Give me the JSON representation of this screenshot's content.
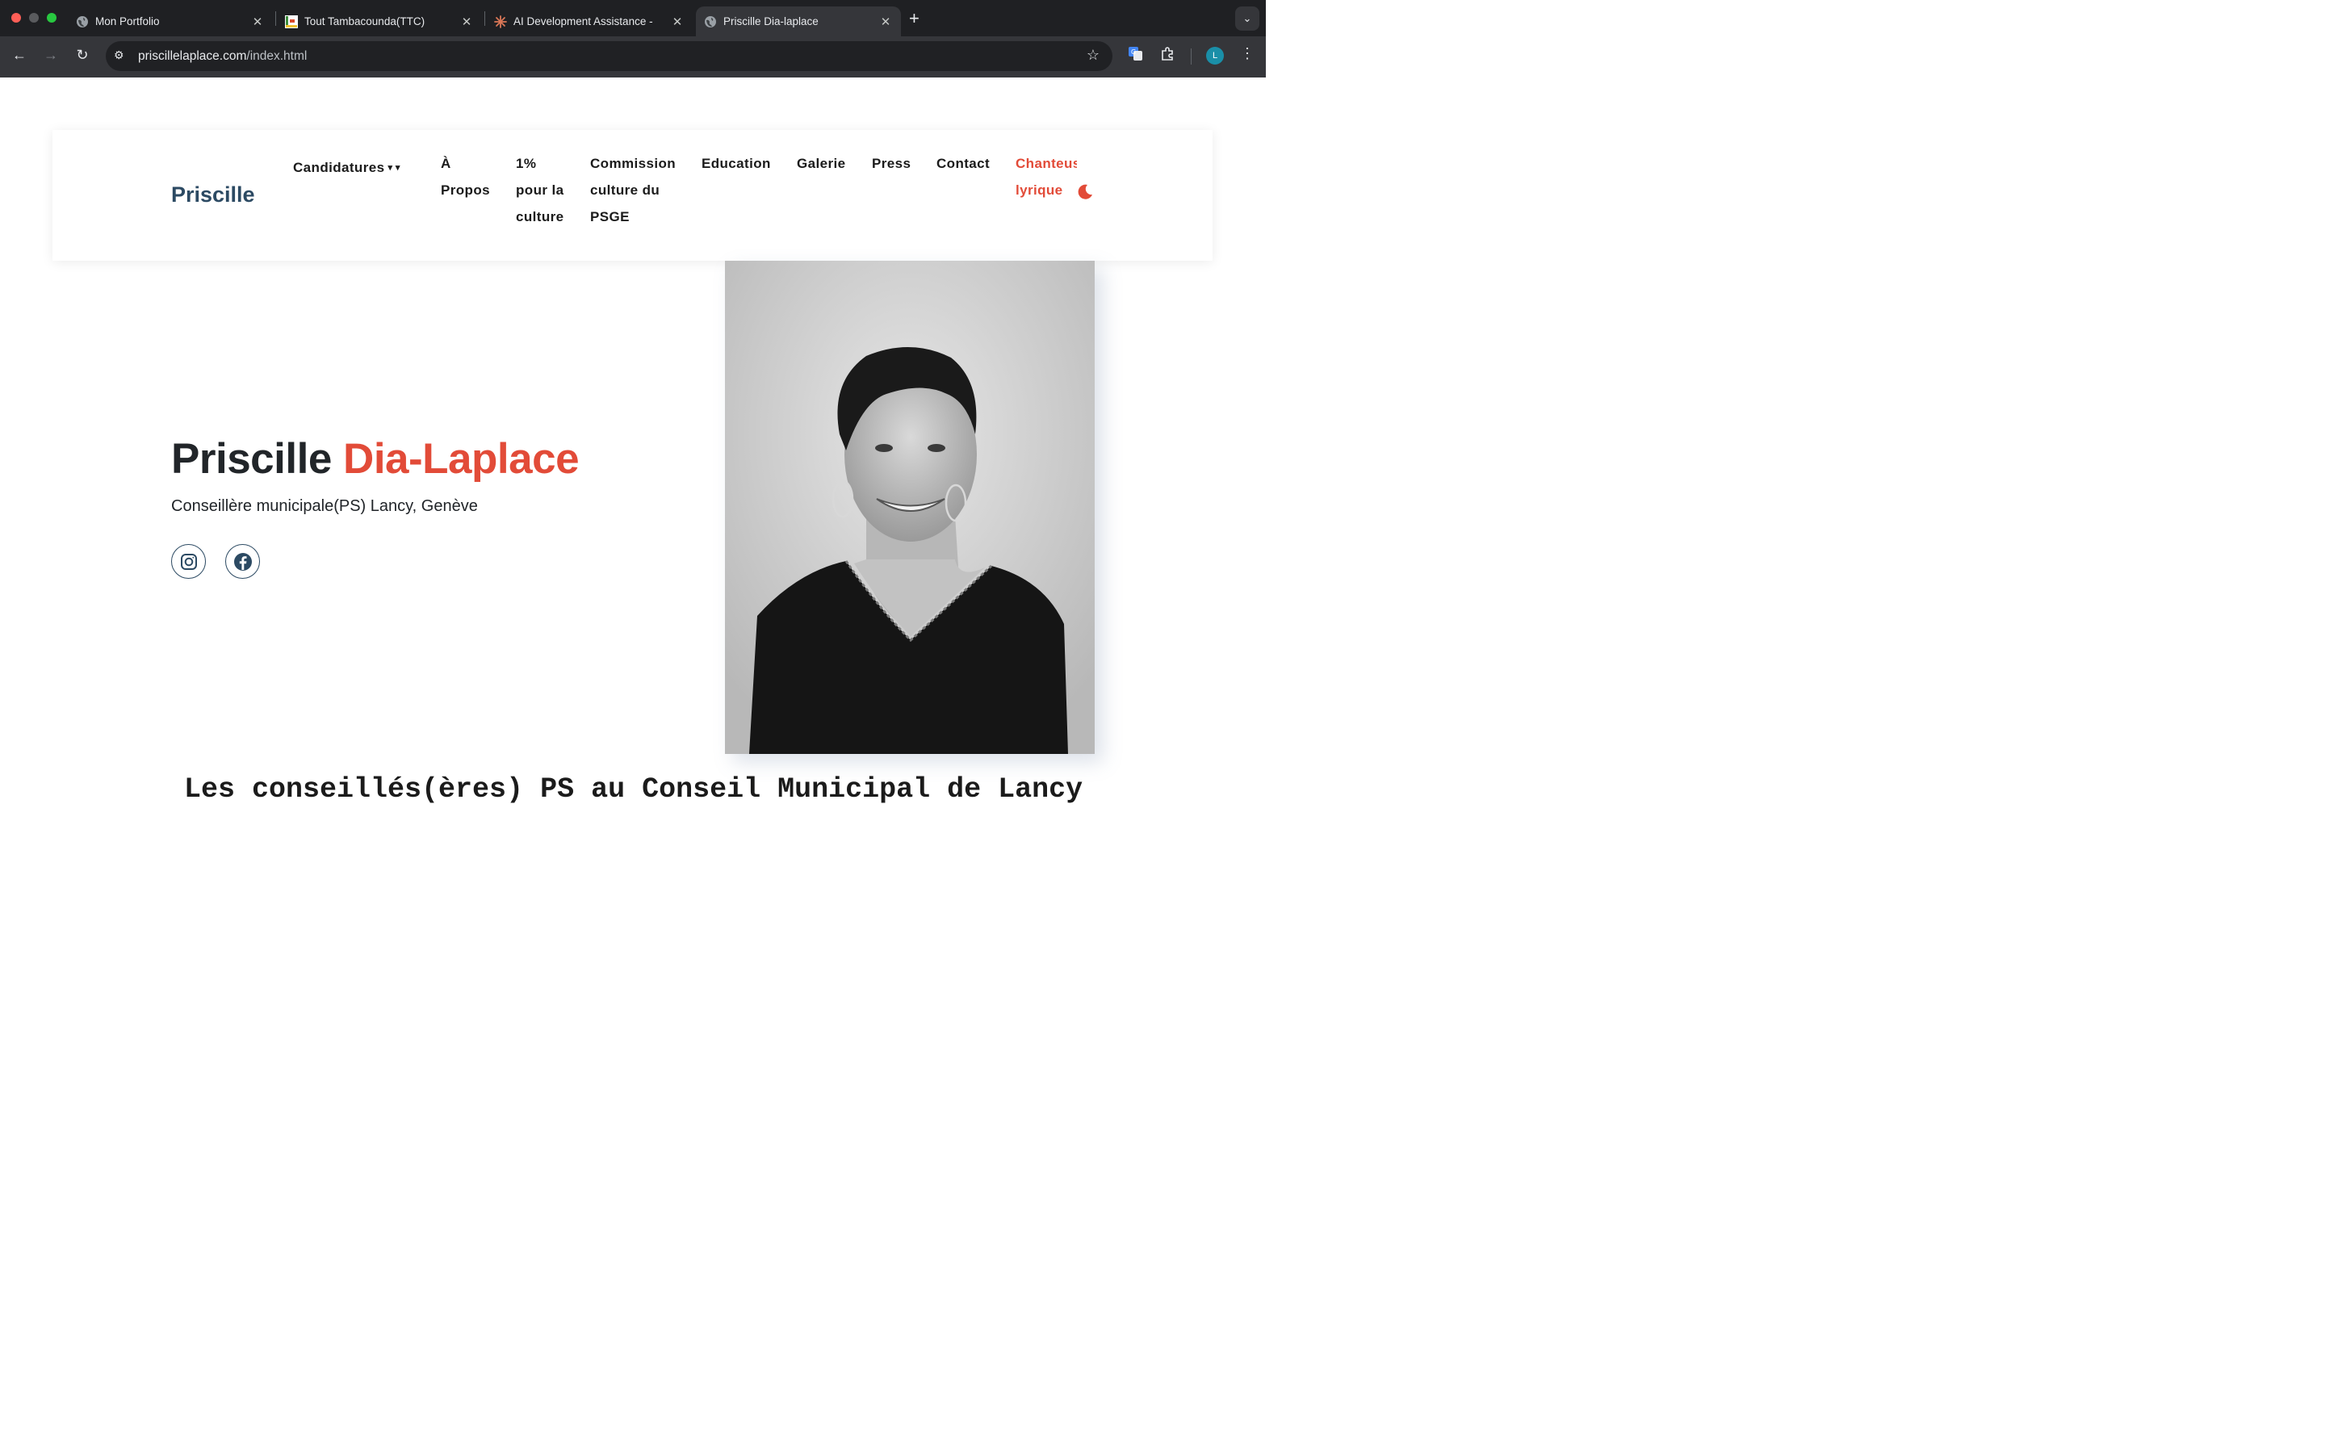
{
  "browser": {
    "tabs": [
      {
        "title": "Mon Portfolio"
      },
      {
        "title": "Tout Tambacounda(TTC)"
      },
      {
        "title": "AI Development Assistance -"
      },
      {
        "title": "Priscille Dia-laplace"
      }
    ],
    "url_domain": "priscillelaplace.com",
    "url_path": "/index.html",
    "profile_initial": "L"
  },
  "nav": {
    "brand": "Priscille",
    "candidatures": "Candidatures",
    "a_propos_1": "À",
    "a_propos_2": "Propos",
    "culture_1": "1%",
    "culture_2": "pour la",
    "culture_3": "culture",
    "commission_1": "Commission",
    "commission_2": "culture du",
    "commission_3": "PSGE",
    "education": "Education",
    "galerie": "Galerie",
    "press": "Press",
    "contact": "Contact",
    "chanteuse_1": "Chanteus",
    "chanteuse_2": "lyrique"
  },
  "hero": {
    "first_name": "Priscille",
    "last_name": "Dia-Laplace",
    "subtitle": "Conseillère municipale(PS) Lancy, Genève"
  },
  "section": {
    "heading": "Les conseillés(ères) PS au Conseil Municipal de Lancy"
  },
  "colors": {
    "accent": "#e24b38",
    "brand": "#2c4a63"
  },
  "icons": [
    "globe-icon",
    "ttc-favicon-icon",
    "asterisk-icon",
    "instagram-icon",
    "facebook-icon",
    "moon-icon"
  ]
}
